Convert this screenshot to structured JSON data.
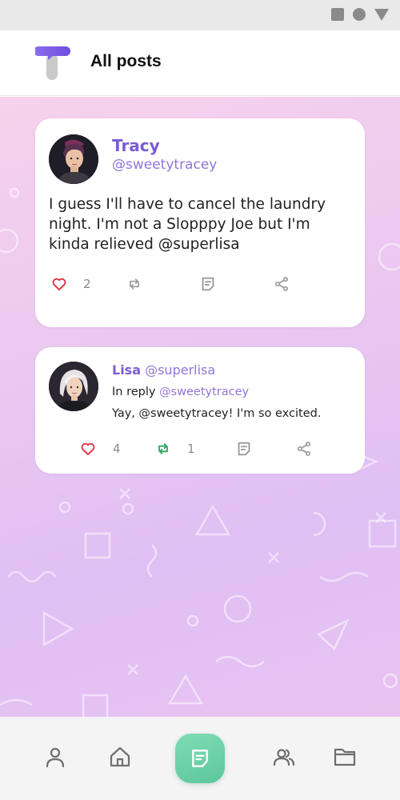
{
  "header": {
    "title": "All posts"
  },
  "post": {
    "author_name": "Tracy",
    "author_handle": "@sweetytracey",
    "text": "I guess I'll have to cancel the laundry night. I'm not a Slopppy Joe but I'm kinda relieved @superlisa",
    "likes": "2",
    "icons": {
      "like": "heart-outline-icon",
      "repost": "repost-icon",
      "comment": "comment-icon",
      "share": "share-icon"
    }
  },
  "reply": {
    "author_name": "Lisa",
    "author_handle": "@superlisa",
    "in_reply_prefix": "In reply",
    "in_reply_handle": "@sweetytracey",
    "text": "Yay, @sweetytracey! I'm so excited.",
    "likes": "4",
    "reposts": "1",
    "icons": {
      "like": "heart-outline-icon",
      "repost": "repost-active-icon",
      "comment": "comment-icon",
      "share": "share-icon"
    }
  },
  "navbar": {
    "items": [
      "profile-icon",
      "home-icon",
      "posts-icon",
      "people-icon",
      "folder-icon"
    ],
    "active": "posts-icon"
  },
  "colors": {
    "accent": "#7b5bd6",
    "like": "#e0303e",
    "repost_active": "#2fa860",
    "fab": "#6fd3a8"
  }
}
